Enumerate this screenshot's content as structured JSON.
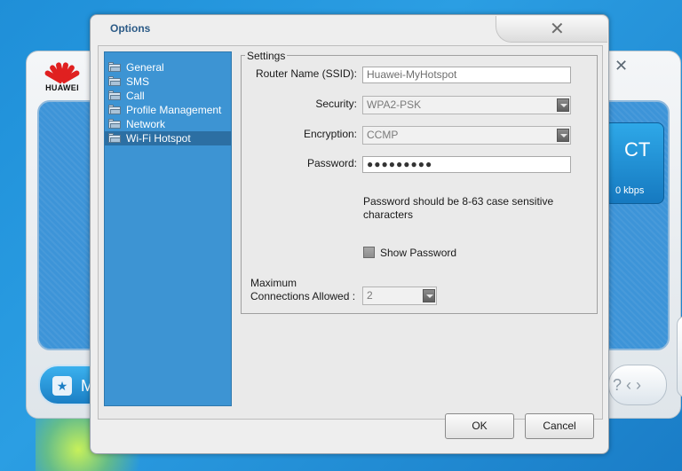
{
  "background_app": {
    "logo_text": "HUAWEI",
    "connect_label_partial": "CT",
    "speed_partial": "0 kbps",
    "bottom_button_partial": "M",
    "close_glyph": "✕",
    "nav_glyphs": "? ‹ ›",
    "side_arrow_glyph": "▶"
  },
  "dialog": {
    "title": "Options",
    "close_glyph": "✕",
    "nav": {
      "items": [
        {
          "label": "General",
          "selected": false
        },
        {
          "label": "SMS",
          "selected": false
        },
        {
          "label": "Call",
          "selected": false
        },
        {
          "label": "Profile Management",
          "selected": false
        },
        {
          "label": "Network",
          "selected": false
        },
        {
          "label": "Wi-Fi Hotspot",
          "selected": true
        }
      ]
    },
    "settings": {
      "legend": "Settings",
      "ssid_label": "Router Name (SSID):",
      "ssid_value": "Huawei-MyHotspot",
      "security_label": "Security:",
      "security_value": "WPA2-PSK",
      "encryption_label": "Encryption:",
      "encryption_value": "CCMP",
      "password_label": "Password:",
      "password_value": "●●●●●●●●●",
      "password_hint": "Password should be 8-63 case sensitive characters",
      "show_password_label": "Show Password",
      "show_password_checked": false,
      "max_conn_label_line1": "Maximum",
      "max_conn_label_line2": "Connections Allowed :",
      "max_conn_value": "2"
    },
    "buttons": {
      "ok": "OK",
      "cancel": "Cancel"
    }
  },
  "colors": {
    "desktop_blue": "#2b9ee3",
    "nav_panel": "#3d94d3",
    "nav_selected": "#2c6fa3",
    "title_text": "#2b5a86"
  }
}
